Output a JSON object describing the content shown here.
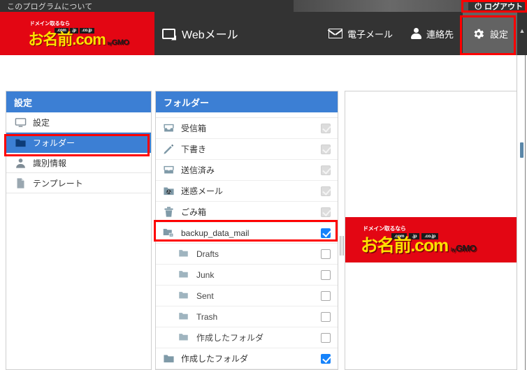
{
  "topbar": {
    "about_label": "このプログラムについて",
    "logout_label": "ログアウト",
    "power_icon": "power-icon"
  },
  "header": {
    "logo": {
      "tagline": "ドメイン取るなら",
      "tlds": [
        ".com",
        ".jp",
        ".co.jp"
      ],
      "brand_prefix": "お名前",
      "brand_suffix": ".com",
      "by": "by",
      "gmo": "GMO"
    },
    "webmail_label": "Webメール",
    "webmail_icon": "screen-icon",
    "nav": [
      {
        "label": "電子メール",
        "icon": "mail-icon",
        "active": false
      },
      {
        "label": "連絡先",
        "icon": "person-icon",
        "active": false
      },
      {
        "label": "設定",
        "icon": "gear-icon",
        "active": true
      }
    ],
    "caret_icon": "caret-up-icon"
  },
  "settings_panel": {
    "title": "設定",
    "items": [
      {
        "label": "設定",
        "icon": "monitor-icon",
        "selected": false
      },
      {
        "label": "フォルダー",
        "icon": "folder-icon",
        "selected": true
      },
      {
        "label": "識別情報",
        "icon": "identity-icon",
        "selected": false
      },
      {
        "label": "テンプレート",
        "icon": "document-icon",
        "selected": false
      }
    ]
  },
  "folder_panel": {
    "title": "フォルダー",
    "search_icon": "search-icon",
    "rows": [
      {
        "label": "受信箱",
        "icon": "inbox-icon",
        "indent": false,
        "checkbox": "disabled-checked",
        "highlight": false
      },
      {
        "label": "下書き",
        "icon": "pencil-icon",
        "indent": false,
        "checkbox": "disabled-checked",
        "highlight": false
      },
      {
        "label": "送信済み",
        "icon": "sent-icon",
        "indent": false,
        "checkbox": "disabled-checked",
        "highlight": false
      },
      {
        "label": "迷惑メール",
        "icon": "junk-icon",
        "indent": false,
        "checkbox": "disabled-checked",
        "highlight": false
      },
      {
        "label": "ごみ箱",
        "icon": "trash-icon",
        "indent": false,
        "checkbox": "disabled-checked",
        "highlight": false
      },
      {
        "label": "backup_data_mail",
        "icon": "folders-icon",
        "indent": false,
        "checkbox": "checked",
        "highlight": true
      },
      {
        "label": "Drafts",
        "icon": "folder-icon",
        "indent": true,
        "checkbox": "unchecked",
        "highlight": false
      },
      {
        "label": "Junk",
        "icon": "folder-icon",
        "indent": true,
        "checkbox": "unchecked",
        "highlight": false
      },
      {
        "label": "Sent",
        "icon": "folder-icon",
        "indent": true,
        "checkbox": "unchecked",
        "highlight": false
      },
      {
        "label": "Trash",
        "icon": "folder-icon",
        "indent": true,
        "checkbox": "unchecked",
        "highlight": false
      },
      {
        "label": "作成したフォルダ",
        "icon": "folder-icon",
        "indent": true,
        "checkbox": "unchecked",
        "highlight": false
      },
      {
        "label": "作成したフォルダ",
        "icon": "folder-icon",
        "indent": false,
        "checkbox": "checked",
        "highlight": false
      }
    ]
  },
  "right_panel": {
    "ad": {
      "tagline": "ドメイン取るなら",
      "tlds": [
        ".com",
        ".jp",
        ".co.jp"
      ],
      "brand_prefix": "お名前",
      "brand_suffix": ".com",
      "by": "by",
      "gmo": "GMO"
    }
  },
  "colors": {
    "brand_red": "#e30613",
    "accent_blue": "#3c7fd4",
    "checkbox_blue": "#1683fb",
    "annotation_red": "#fe0000",
    "header_dark": "#333333",
    "logo_yellow": "#ffe000"
  }
}
